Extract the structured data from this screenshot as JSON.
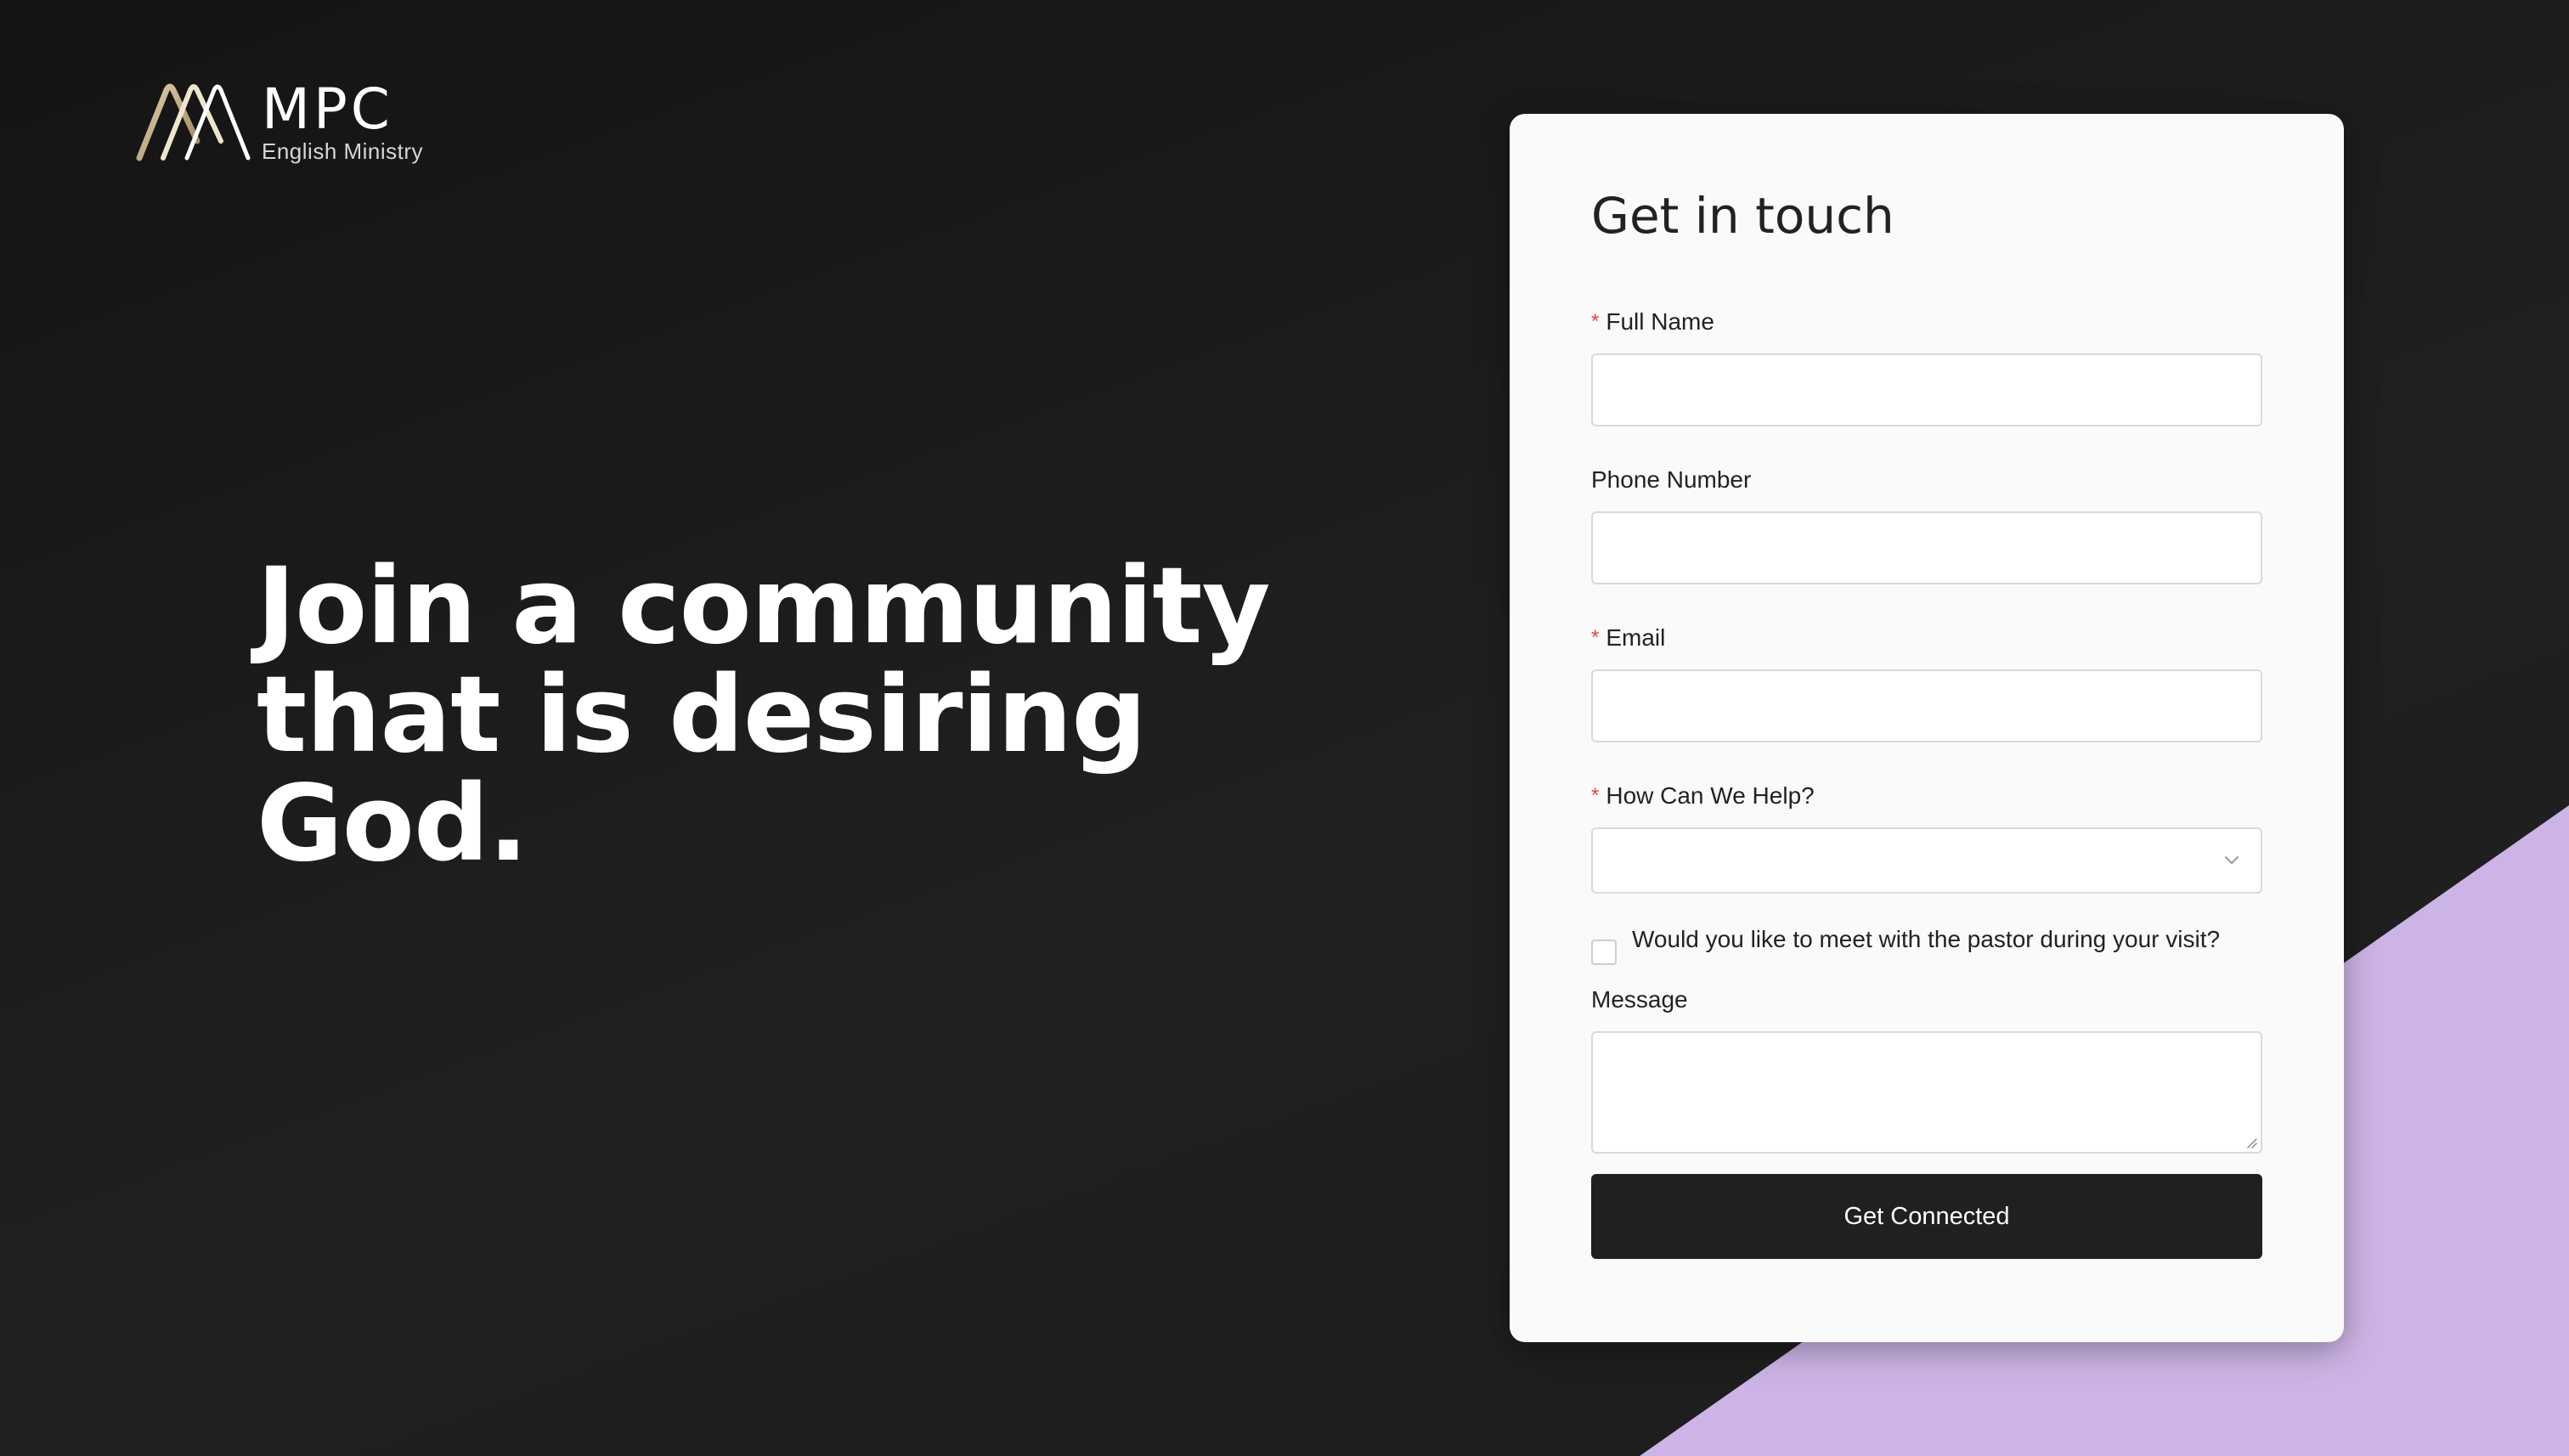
{
  "brand": {
    "name": "MPC",
    "subtitle": "English Ministry",
    "logo_icon": "mountain-logo-icon"
  },
  "hero": {
    "heading_lines": [
      "Join a community",
      "that is desiring",
      "God."
    ]
  },
  "form": {
    "title": "Get in touch",
    "fields": {
      "full_name": {
        "label": "Full Name",
        "required": true,
        "value": ""
      },
      "phone": {
        "label": "Phone Number",
        "required": false,
        "value": ""
      },
      "email": {
        "label": "Email",
        "required": true,
        "value": ""
      },
      "help": {
        "label": "How Can We Help?",
        "required": true,
        "selected": ""
      },
      "pastor_meet": {
        "label": "Would you like to meet with the pastor during your visit?",
        "checked": false
      },
      "message": {
        "label": "Message",
        "required": false,
        "value": ""
      }
    },
    "submit_label": "Get Connected",
    "required_marker": "*"
  },
  "colors": {
    "background": "#1c1c1c",
    "accent_purple": "#cdb4e6",
    "card": "#fafafa",
    "button": "#202020",
    "required": "#e0453a",
    "logo_gold": "#b8a27a"
  }
}
